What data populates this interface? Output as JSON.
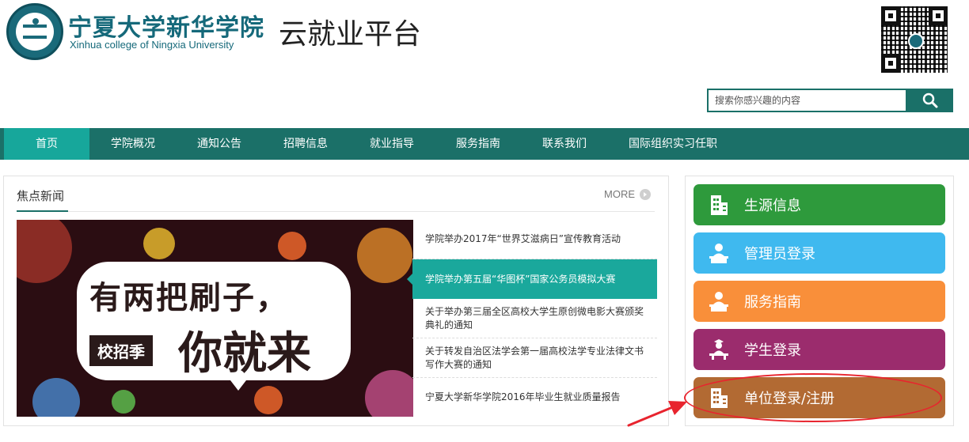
{
  "header": {
    "school_name_cn": "宁夏大学新华学院",
    "school_name_en": "Xinhua college of Ningxia University",
    "platform_title": "云就业平台",
    "logo_icon": "university-emblem-icon",
    "qr_icon": "qr-code-icon"
  },
  "search": {
    "placeholder": "搜索你感兴趣的内容",
    "button_icon": "search-icon"
  },
  "nav": {
    "items": [
      {
        "label": "首页",
        "active": true
      },
      {
        "label": "学院概况"
      },
      {
        "label": "通知公告"
      },
      {
        "label": "招聘信息"
      },
      {
        "label": "就业指导"
      },
      {
        "label": "服务指南"
      },
      {
        "label": "联系我们"
      },
      {
        "label": "国际组织实习任职"
      }
    ]
  },
  "news": {
    "title": "焦点新闻",
    "more_label": "MORE",
    "banner": {
      "line1": "有两把刷子，",
      "badge": "校招季",
      "line2": "你就来"
    },
    "items": [
      {
        "text": "学院举办2017年“世界艾滋病日”宣传教育活动"
      },
      {
        "text": "学院举办第五届“华图杯”国家公务员模拟大赛",
        "active": true
      },
      {
        "text": "关于举办第三届全区高校大学生原创微电影大赛颁奖典礼的通知"
      },
      {
        "text": "关于转发自治区法学会第一届高校法学专业法律文书写作大赛的通知"
      },
      {
        "text": "宁夏大学新华学院2016年毕业生就业质量报告"
      }
    ]
  },
  "side": {
    "buttons": [
      {
        "label": "生源信息",
        "icon": "building-icon",
        "color": "#2e9a3c"
      },
      {
        "label": "管理员登录",
        "icon": "admin-desk-icon",
        "color": "#3fb9ef"
      },
      {
        "label": "服务指南",
        "icon": "service-desk-icon",
        "color": "#f98f3a"
      },
      {
        "label": "学生登录",
        "icon": "student-icon",
        "color": "#9b2c6d"
      },
      {
        "label": "单位登录/注册",
        "icon": "building-icon",
        "color": "#b26a33"
      }
    ]
  },
  "colors": {
    "nav_bg": "#1b7068",
    "nav_active": "#17a79b",
    "accent": "#1aa89c",
    "annotation": "#e8242e"
  }
}
